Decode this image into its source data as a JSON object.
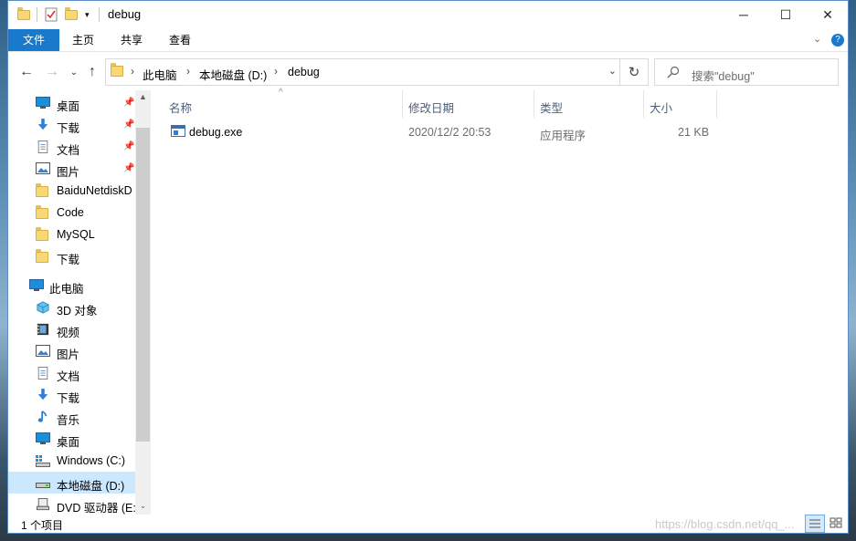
{
  "window": {
    "title": "debug"
  },
  "ribbon": {
    "tabs": [
      "文件",
      "主页",
      "共享",
      "查看"
    ]
  },
  "address": {
    "crumbs": [
      "此电脑",
      "本地磁盘 (D:)",
      "debug"
    ]
  },
  "search": {
    "placeholder": "搜索\"debug\""
  },
  "sidebar": {
    "quick_access": [
      {
        "label": "桌面",
        "icon": "desktop-icon",
        "pinned": true
      },
      {
        "label": "下载",
        "icon": "download-icon",
        "pinned": true
      },
      {
        "label": "文档",
        "icon": "document-icon",
        "pinned": true
      },
      {
        "label": "图片",
        "icon": "picture-icon",
        "pinned": true
      },
      {
        "label": "BaiduNetdiskD",
        "icon": "folder-icon",
        "pinned": false
      },
      {
        "label": "Code",
        "icon": "folder-icon",
        "pinned": false
      },
      {
        "label": "MySQL",
        "icon": "folder-icon",
        "pinned": false
      },
      {
        "label": "下载",
        "icon": "folder-icon",
        "pinned": false
      }
    ],
    "this_pc": "此电脑",
    "pc_items": [
      {
        "label": "3D 对象",
        "icon": "cube-icon"
      },
      {
        "label": "视频",
        "icon": "video-icon"
      },
      {
        "label": "图片",
        "icon": "picture-icon"
      },
      {
        "label": "文档",
        "icon": "document-icon"
      },
      {
        "label": "下载",
        "icon": "download-icon"
      },
      {
        "label": "音乐",
        "icon": "music-icon"
      },
      {
        "label": "桌面",
        "icon": "desktop-icon"
      },
      {
        "label": "Windows (C:)",
        "icon": "drive-c-icon"
      },
      {
        "label": "本地磁盘 (D:)",
        "icon": "drive-icon",
        "selected": true
      },
      {
        "label": "DVD 驱动器 (E:)",
        "icon": "dvd-icon"
      }
    ]
  },
  "columns": [
    "名称",
    "修改日期",
    "类型",
    "大小"
  ],
  "files": [
    {
      "name": "debug.exe",
      "modified": "2020/12/2 20:53",
      "type": "应用程序",
      "size": "21 KB"
    }
  ],
  "status": {
    "count": "1 个项目"
  },
  "watermark": "https://blog.csdn.net/qq_..."
}
